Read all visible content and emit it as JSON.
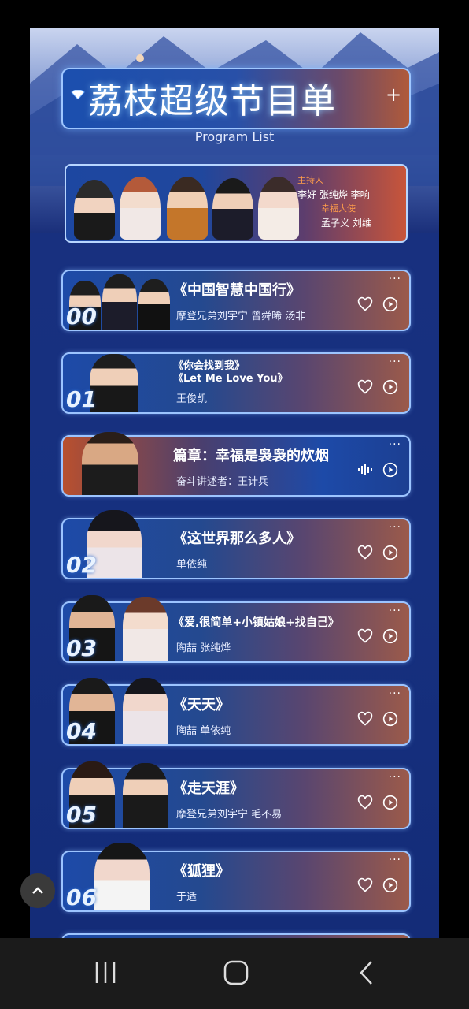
{
  "header": {
    "title": "荔枝超级节目单",
    "plus": "+",
    "subtitle": "Program List"
  },
  "hosts": {
    "label_hosts": "主持人",
    "names_hosts": "李好 张纯烨 李响",
    "label_ambassadors": "幸福大使",
    "names_ambassadors": "孟子义 刘维"
  },
  "programs": [
    {
      "num": "00",
      "title": "《中国智慧中国行》",
      "artists": "摩登兄弟刘宇宁    曾舜晞    汤非"
    },
    {
      "num": "01",
      "title_line1": "《你会找到我》",
      "title_line2": "《Let Me Love You》",
      "artists": "王俊凯"
    },
    {
      "num": "",
      "title": "篇章：幸福是袅袅的炊烟",
      "artists": "奋斗讲述者：王计兵"
    },
    {
      "num": "02",
      "title": "《这世界那么多人》",
      "artists": "单依纯"
    },
    {
      "num": "03",
      "title": "《爱,很简单+小镇姑娘+找自己》",
      "artists": "陶喆    张纯烨"
    },
    {
      "num": "04",
      "title": "《天天》",
      "artists": "陶喆    单依纯"
    },
    {
      "num": "05",
      "title": "《走天涯》",
      "artists": "摩登兄弟刘宇宁    毛不易"
    },
    {
      "num": "06",
      "title": "《狐狸》",
      "artists": "于适"
    }
  ],
  "icons": {
    "more": "···",
    "heart": "heart-icon",
    "play": "play-icon",
    "wave": "audio-wave-icon",
    "scroll_up": "chevron-up-icon"
  },
  "colors": {
    "background": "#16307f",
    "accent_orange": "#ff9c4a",
    "card_border": "#9cc4ff"
  }
}
